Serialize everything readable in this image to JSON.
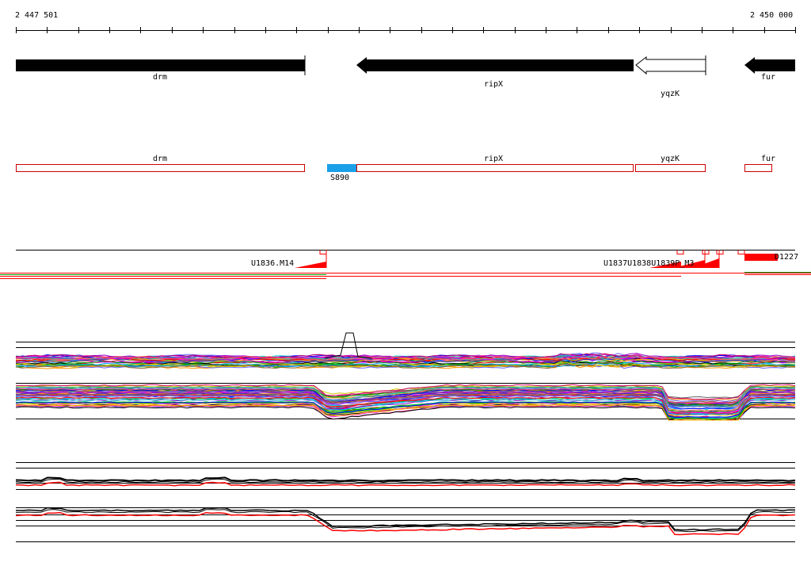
{
  "ruler": {
    "start_label": "2 447 501",
    "end_label": "2 450 000"
  },
  "annotation_track": {
    "genes": [
      {
        "name": "drm",
        "strand": "forward",
        "fill": "#000000"
      },
      {
        "name": "ripX",
        "strand": "reverse",
        "fill": "#000000"
      },
      {
        "name": "yqzK",
        "strand": "reverse",
        "fill": "#ffffff"
      },
      {
        "name": "fur",
        "strand": "reverse",
        "fill": "#000000"
      }
    ]
  },
  "feature_track": {
    "boxes": [
      {
        "name": "drm",
        "color": "#cc0000"
      },
      {
        "name": "ripX",
        "color": "#cc0000"
      },
      {
        "name": "yqzK",
        "color": "#cc0000"
      },
      {
        "name": "fur",
        "color": "#cc0000"
      }
    ],
    "highlight": {
      "name": "S890",
      "color": "#1a9fe8"
    }
  },
  "segment_track": {
    "labels": [
      "U1836.M14",
      "U1837U1838U1839P_M3",
      "D1227"
    ],
    "color": "#ff0000"
  },
  "colors": {
    "gene_arrow": "#000000",
    "feature_outline": "#cc0000",
    "highlight": "#1a9fe8",
    "segment": "#ff0000",
    "profile_green": "#00aa00"
  }
}
